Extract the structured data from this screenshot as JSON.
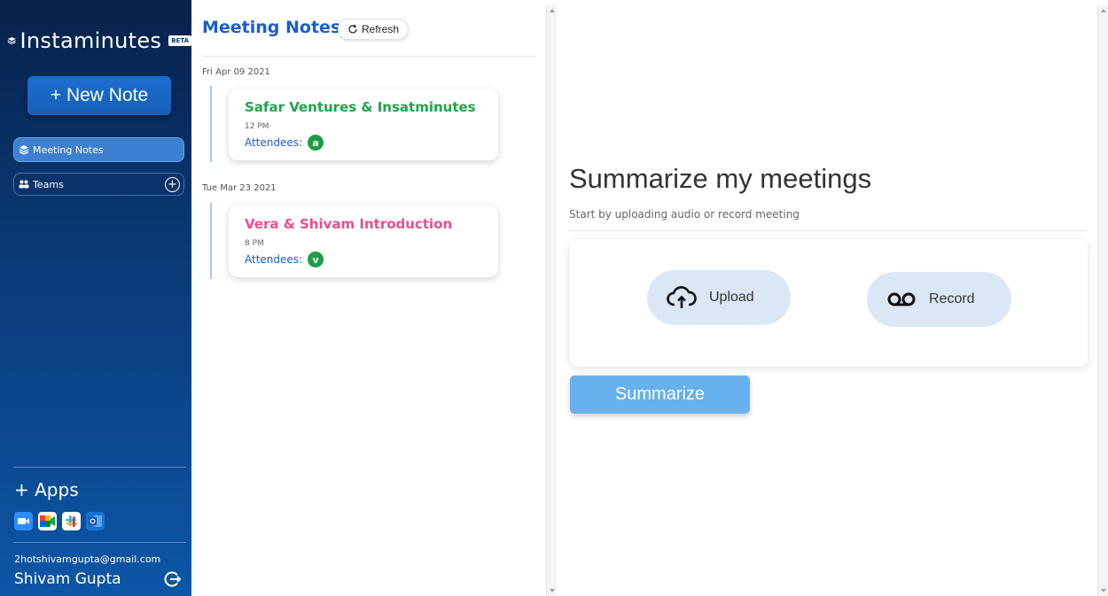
{
  "sidebar": {
    "brand": {
      "name": "Instaminutes",
      "badge": "BETA"
    },
    "new_note_label": "+ New Note",
    "nav": {
      "meeting_notes": "Meeting Notes",
      "teams": "Teams",
      "teams_add": "+"
    },
    "apps_label": "+ Apps",
    "apps": [
      "zoom-icon",
      "google-meet-icon",
      "slack-icon",
      "outlook-icon"
    ],
    "user": {
      "email": "2hotshivamgupta@gmail.com",
      "name": "Shivam Gupta"
    }
  },
  "notes": {
    "title": "Meeting Notes",
    "refresh_label": "Refresh",
    "groups": [
      {
        "date": "Fri Apr 09 2021",
        "card": {
          "title": "Safar Ventures & Insatminutes",
          "time": "12 PM",
          "attendees_label": "Attendees:",
          "attendee_initial": "a",
          "title_color": "#1ea54a"
        }
      },
      {
        "date": "Tue Mar 23 2021",
        "card": {
          "title": "Vera & Shivam Introduction",
          "time": "8 PM",
          "attendees_label": "Attendees:",
          "attendee_initial": "v",
          "title_color": "#e94e8f"
        }
      }
    ]
  },
  "main": {
    "title": "Summarize my meetings",
    "subtitle": "Start by uploading audio or record meeting",
    "upload_label": "Upload",
    "record_label": "Record",
    "summarize_label": "Summarize"
  },
  "colors": {
    "accent": "#1a5bd6",
    "sidebar_top": "#07224b",
    "sidebar_bottom": "#0d56a6",
    "summarize_button": "#67b1ee",
    "pill_bg": "#dce7f5"
  }
}
